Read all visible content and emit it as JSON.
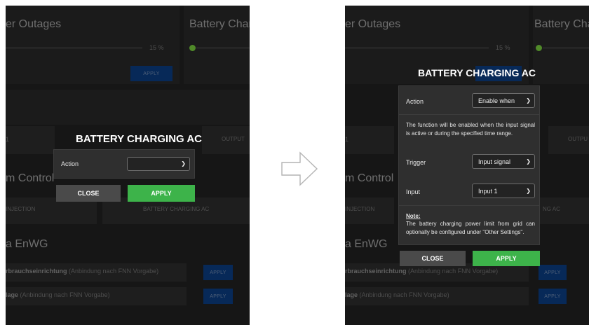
{
  "background": {
    "power_outages_title": "er Outages",
    "battery_charging_title": "Battery Chargin",
    "battery_charging_title_right": "Battery Charg",
    "percent": "15 %",
    "apply": "APPLY",
    "output_1": "1",
    "output_label": "OUTPUT",
    "output_label_right": "OUTPU",
    "control_title": "m Control",
    "injection_label": "INJECTION",
    "battery_charging_ac_small": "BATTERY CHARGING AC",
    "battery_charging_ac_small_right": "NG AC",
    "enwg_title": "a EnWG",
    "row1_bold": "rbrauchseinrichtung",
    "row1_dim": " (Anbindung nach FNN Vorgabe)",
    "row1_bold_right": "rbrauchseinrichtung",
    "row2_bold": "lage",
    "row2_dim": " (Anbindung nach FNN Vorgabe)"
  },
  "left_dialog": {
    "title": "BATTERY CHARGING AC",
    "action_label": "Action",
    "action_value": "",
    "close": "CLOSE",
    "apply": "APPLY"
  },
  "right_dialog": {
    "title": "BATTERY CHARGING AC",
    "action_label": "Action",
    "action_value": "Enable when",
    "description": "The function will be enabled when the input signal is active or during the specified time range.",
    "trigger_label": "Trigger",
    "trigger_value": "Input signal",
    "input_label": "Input",
    "input_value": "Input 1",
    "note_title": "Note:",
    "note_text": "The battery charging power limit from grid can optionally be configured under \"Other Settings\".",
    "close": "CLOSE",
    "apply": "APPLY"
  },
  "colors": {
    "panel_bg": "#1f1f1f",
    "dialog_bg": "#2f2f2f",
    "apply_green": "#3db34a",
    "close_gray": "#4a4a4a",
    "bg_apply_blue": "#0a3a7a",
    "status_dot": "#6fbf3a"
  },
  "icons": {
    "transition_arrow": "arrow-right-outline-icon",
    "select_chevron": "chevron-down-icon"
  }
}
